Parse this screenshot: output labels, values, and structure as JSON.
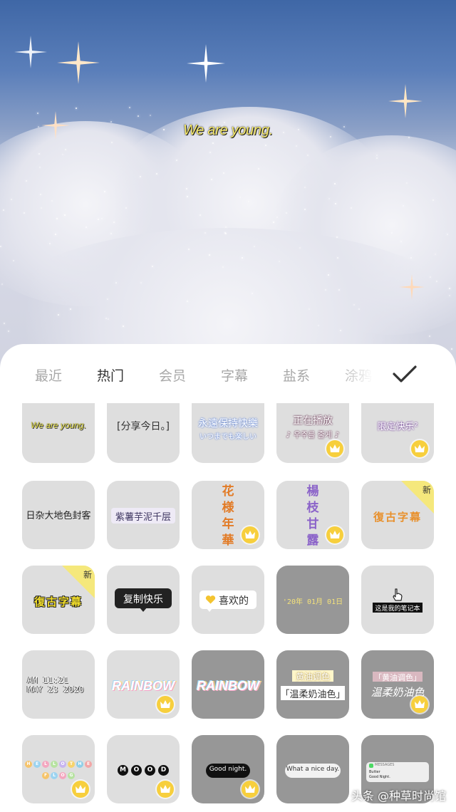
{
  "preview": {
    "caption": "We are young."
  },
  "tabs": [
    {
      "label": "最近"
    },
    {
      "label": "热门",
      "active": true
    },
    {
      "label": "会员"
    },
    {
      "label": "字幕"
    },
    {
      "label": "盐系"
    },
    {
      "label": "涂鸦"
    }
  ],
  "confirm_icon": "checkmark-icon",
  "stickers": {
    "r1c1": "We are young.",
    "r1c2": "[分享今日。]",
    "r1c3_top": "永遠保持快樂",
    "r1c3_bottom": "いつまでも楽しい",
    "r1c4_top": "正在播放",
    "r1c4_bottom": "♪ 우주를 줄게 ♪",
    "r1c5": "限定快乐²",
    "r2c1": "日杂大地色封客",
    "r2c2": "紫薯芋泥千层",
    "r2c3": [
      "花",
      "様",
      "年",
      "華"
    ],
    "r2c4": [
      "楊",
      "枝",
      "甘",
      "露"
    ],
    "r2c5": "復古字幕",
    "r2c5_tag": "新",
    "r3c1": "復古字幕",
    "r3c1_tag": "新",
    "r3c2": "复制快乐",
    "r3c3": "喜欢的",
    "r3c4": "'20年 01月 01日",
    "r3c5": "这是我的笔记本",
    "r4c1_line1": "AM 11:21",
    "r4c1_line2": "MAY 23 2020",
    "r4c2": "RAINBOW",
    "r4c3": "RAINBOW",
    "r4c4_top": "黄油调色",
    "r4c4_bottom": "「温柔奶油色」",
    "r4c5_top": "「黄油调色」",
    "r4c5_bottom": "温柔奶油色",
    "r5c1_row1": [
      "H",
      "E",
      "L",
      "L",
      "O",
      "T",
      "H",
      "E"
    ],
    "r5c1_row2": [
      "F",
      "L",
      "O",
      "G"
    ],
    "r5c2": [
      "M",
      "O",
      "O",
      "D"
    ],
    "r5c3": "Good night.",
    "r5c4": "What a nice day.",
    "r5c5_app": "MESSAGES",
    "r5c5_from": "Butter",
    "r5c5_msg": "Good Night."
  },
  "watermark": "头条 @种草时尚馆",
  "colors": {
    "crown": "#f7cf3d",
    "new_tag": "#f5e87c",
    "caption": "#f7ea6a"
  }
}
